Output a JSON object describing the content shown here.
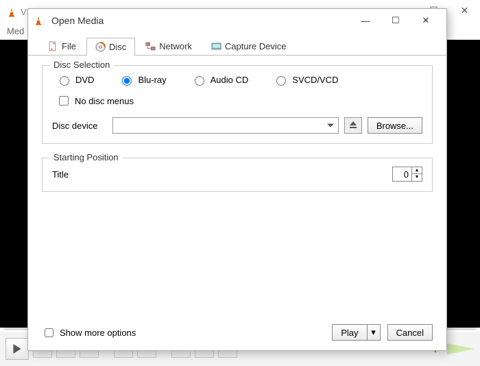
{
  "bg": {
    "title": "VLC media player",
    "menu_first": "Med",
    "winbtns": {
      "min": "—",
      "max": "☐",
      "close": "✕"
    }
  },
  "dialog": {
    "title": "Open Media",
    "winbtns": {
      "min": "—",
      "max": "☐",
      "close": "✕"
    },
    "tabs": {
      "file": "File",
      "disc": "Disc",
      "network": "Network",
      "capture": "Capture Device"
    },
    "disc_selection": {
      "legend": "Disc Selection",
      "options": {
        "dvd": "DVD",
        "bluray": "Blu-ray",
        "audiocd": "Audio CD",
        "svcd": "SVCD/VCD"
      },
      "selected": "bluray",
      "no_disc_menus": "No disc menus",
      "device_label": "Disc device",
      "device_value": "",
      "browse": "Browse..."
    },
    "starting_position": {
      "legend": "Starting Position",
      "title_label": "Title",
      "title_value": "0"
    },
    "show_more": "Show more options",
    "play": "Play",
    "cancel": "Cancel"
  },
  "icons": {
    "dropdown_caret": "▾",
    "eject": "⏏",
    "spinner_up": "▲",
    "spinner_down": "▼",
    "play_triangle": "▶"
  }
}
